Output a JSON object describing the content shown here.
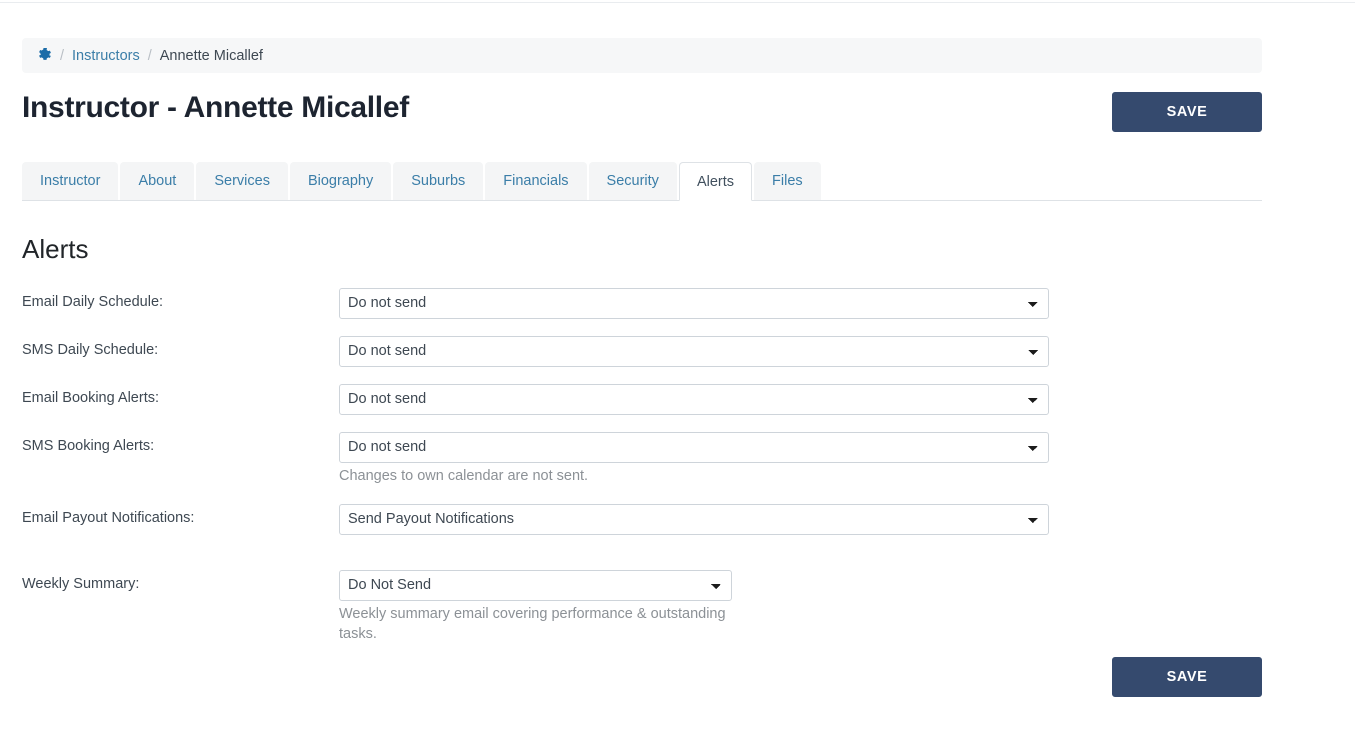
{
  "breadcrumb": {
    "home_icon": "gear-icon",
    "separator": "/",
    "items": [
      {
        "label": "Instructors",
        "current": false
      },
      {
        "label": "Annette Micallef",
        "current": true
      }
    ]
  },
  "header": {
    "title": "Instructor - Annette Micallef",
    "save_label": "SAVE"
  },
  "tabs": [
    {
      "label": "Instructor",
      "active": false
    },
    {
      "label": "About",
      "active": false
    },
    {
      "label": "Services",
      "active": false
    },
    {
      "label": "Biography",
      "active": false
    },
    {
      "label": "Suburbs",
      "active": false
    },
    {
      "label": "Financials",
      "active": false
    },
    {
      "label": "Security",
      "active": false
    },
    {
      "label": "Alerts",
      "active": true
    },
    {
      "label": "Files",
      "active": false
    }
  ],
  "section": {
    "title": "Alerts"
  },
  "form": {
    "rows": [
      {
        "label": "Email Daily Schedule:",
        "value": "Do not send",
        "help": "",
        "width": "wide"
      },
      {
        "label": "SMS Daily Schedule:",
        "value": "Do not send",
        "help": "",
        "width": "wide"
      },
      {
        "label": "Email Booking Alerts:",
        "value": "Do not send",
        "help": "",
        "width": "wide"
      },
      {
        "label": "SMS Booking Alerts:",
        "value": "Do not send",
        "help": "Changes to own calendar are not sent.",
        "width": "wide"
      },
      {
        "label": "Email Payout Notifications:",
        "value": "Send Payout Notifications",
        "help": "",
        "width": "wide"
      },
      {
        "label": "Weekly Summary:",
        "value": "Do Not Send",
        "help": "Weekly summary email covering performance & outstanding tasks.",
        "width": "narrow"
      }
    ]
  },
  "footer": {
    "save_label": "SAVE"
  },
  "colors": {
    "accent": "#3b7ea8",
    "save_button": "#354a6e",
    "breadcrumb_bg": "#f6f7f8",
    "tab_inactive_bg": "#f4f5f6",
    "border": "#dee2e6",
    "help_text": "#8c9196"
  }
}
